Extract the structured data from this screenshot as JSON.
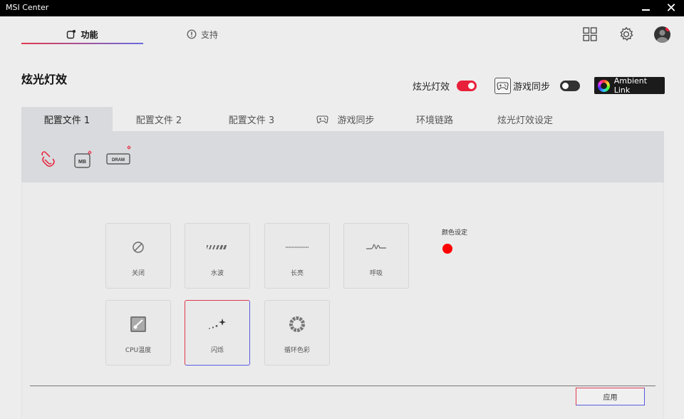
{
  "window": {
    "title": "MSI Center",
    "minimize_icon": "minimize-icon",
    "close_icon": "close-icon",
    "close_glyph": "✕"
  },
  "topnav": {
    "features_label": "功能",
    "support_label": "支持",
    "grid_icon": "grid-icon",
    "settings_icon": "gear-icon"
  },
  "page": {
    "title": "炫光灯效",
    "lighting_toggle_label": "炫光灯效",
    "lighting_toggle_on": true,
    "game_sync_label": "游戏同步",
    "game_sync_on": false,
    "ambient_link_label": "Ambient Link"
  },
  "subtabs": [
    {
      "label": "配置文件 1",
      "active": true
    },
    {
      "label": "配置文件 2",
      "active": false
    },
    {
      "label": "配置文件 3",
      "active": false
    },
    {
      "label": "游戏同步",
      "active": false,
      "icon": "gamepad-icon"
    },
    {
      "label": "环境链路",
      "active": false
    },
    {
      "label": "炫光灯效设定",
      "active": false
    }
  ],
  "devices": [
    {
      "name": "link-device",
      "label": ""
    },
    {
      "name": "motherboard",
      "label": "MB"
    },
    {
      "name": "memory",
      "label": "DRAM"
    }
  ],
  "effects": [
    {
      "label": "关闭",
      "icon": "off-icon",
      "selected": false
    },
    {
      "label": "水波",
      "icon": "wave-icon",
      "selected": false
    },
    {
      "label": "长亮",
      "icon": "steady-icon",
      "selected": false
    },
    {
      "label": "呼吸",
      "icon": "breathing-icon",
      "selected": false
    },
    {
      "label": "CPU温度",
      "icon": "cpu-temperature-icon",
      "selected": false
    },
    {
      "label": "闪烁",
      "icon": "flashing-icon",
      "selected": true
    },
    {
      "label": "循环色彩",
      "icon": "color-cycle-icon",
      "selected": false
    }
  ],
  "color_setting": {
    "label": "颜色设定",
    "color": "#ff0000"
  },
  "apply_label": "应用",
  "colors": {
    "accent_red": "#e8203a",
    "accent_blue": "#5a5be0"
  }
}
